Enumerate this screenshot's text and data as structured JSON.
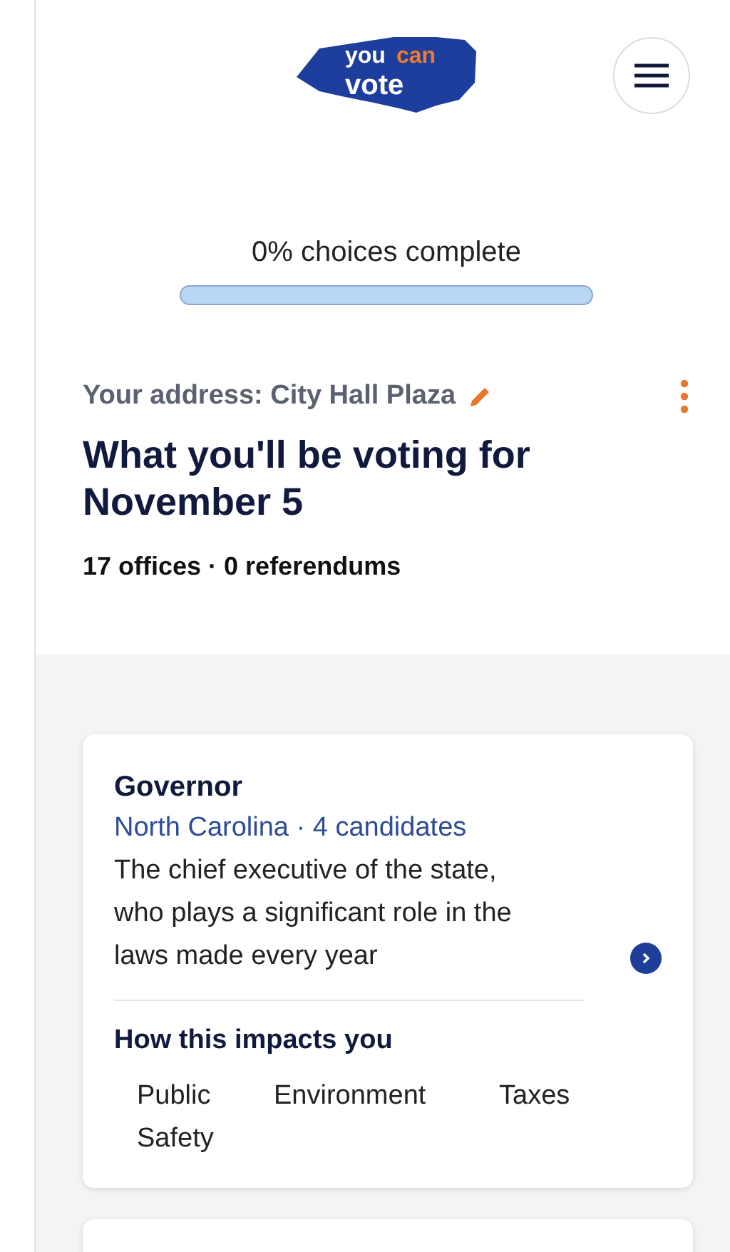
{
  "logo": {
    "word_top": "you",
    "word_accent": "can",
    "word_bottom": "vote"
  },
  "progress": {
    "label": "0% choices complete",
    "level": 0
  },
  "address": {
    "label": "Your address: City Hall Plaza"
  },
  "heading": "What you'll be voting for November 5",
  "summary": "17 offices · 0 referendums",
  "races": [
    {
      "title": "Governor",
      "meta": "North Carolina · 4 candidates",
      "description": "The chief executive of the state, who plays a significant role in the laws made every year",
      "impacts_heading": "How this impacts you",
      "impacts": [
        "Public Safety",
        "Environment",
        "Taxes"
      ]
    }
  ]
}
